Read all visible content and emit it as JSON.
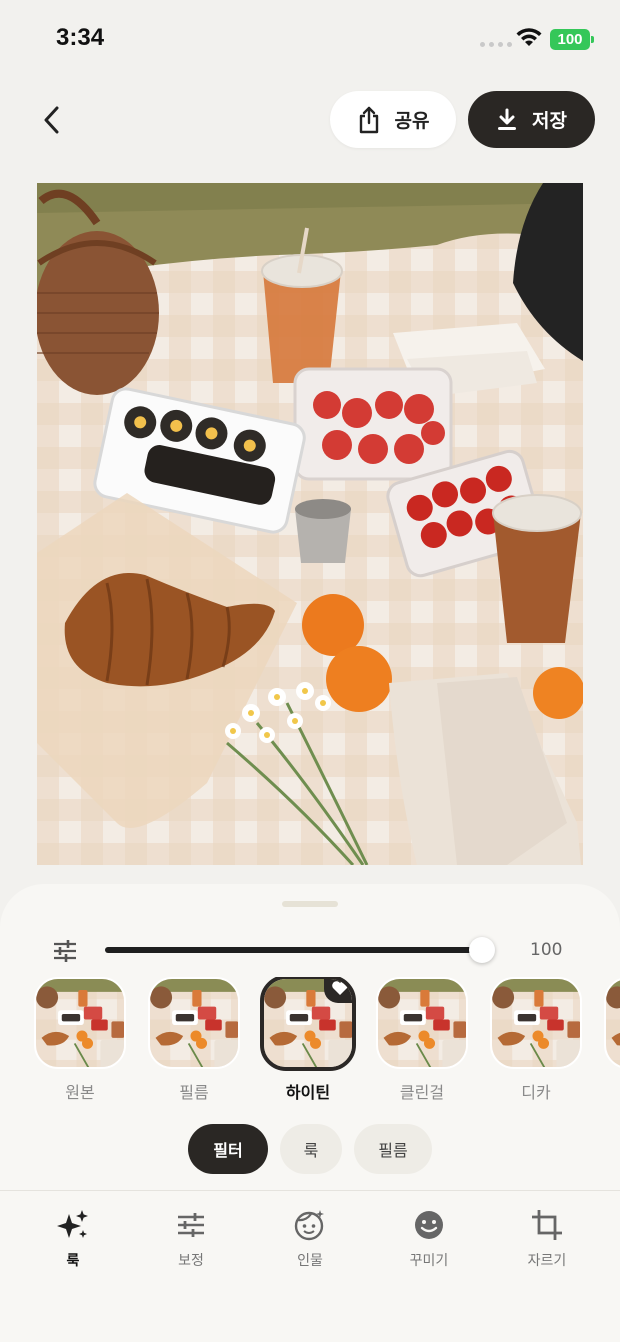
{
  "status_bar": {
    "time": "3:34",
    "battery": "100",
    "battery_color": "#35c759"
  },
  "top_bar": {
    "back_icon": "chevron-left-icon",
    "share_label": "공유",
    "share_icon": "share-icon",
    "save_label": "저장",
    "save_icon": "download-icon"
  },
  "photo": {
    "subject": "picnic-photo"
  },
  "editor": {
    "intensity_icon": "sliders-icon",
    "intensity_value": "100",
    "intensity_fraction": 1.0,
    "filters": [
      {
        "label": "원본",
        "selected": false
      },
      {
        "label": "필름",
        "selected": false
      },
      {
        "label": "하이틴",
        "selected": true,
        "favorite": true
      },
      {
        "label": "클린걸",
        "selected": false
      },
      {
        "label": "디카",
        "selected": false
      }
    ],
    "categories": [
      {
        "label": "필터",
        "active": true
      },
      {
        "label": "룩",
        "active": false
      },
      {
        "label": "필름",
        "active": false
      }
    ]
  },
  "tab_bar": {
    "tabs": [
      {
        "label": "룩",
        "icon": "sparkles-icon",
        "active": true
      },
      {
        "label": "보정",
        "icon": "adjust-icon",
        "active": false
      },
      {
        "label": "인물",
        "icon": "face-retouch-icon",
        "active": false
      },
      {
        "label": "꾸미기",
        "icon": "smiley-sticker-icon",
        "active": false
      },
      {
        "label": "자르기",
        "icon": "crop-icon",
        "active": false
      }
    ]
  },
  "colors": {
    "background": "#f2f1ee",
    "accent_dark": "#2a2724",
    "sheet": "#f8f7f4"
  }
}
